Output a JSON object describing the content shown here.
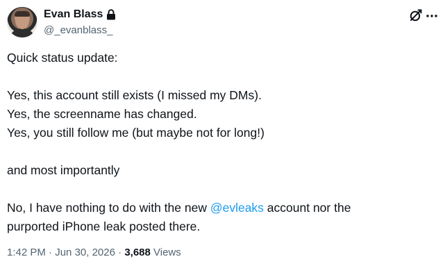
{
  "author": {
    "display_name": "Evan Blass",
    "handle": "@_evanblass_",
    "avatar_icon": "avatar-photo",
    "protected_icon": "lock-icon"
  },
  "header_actions": {
    "grok_icon": "grok-slash-icon",
    "more_icon": "more-dots-icon"
  },
  "tweet": {
    "line1": "Quick status update:",
    "line2": "Yes, this account still exists (I missed my DMs).",
    "line3": "Yes, the screenname has changed.",
    "line4": "Yes, you still follow me (but maybe not for long!)",
    "line5": "and most importantly",
    "line6_before": "No, I have nothing to do with the new ",
    "line6_mention": "@evleaks",
    "line6_after": " account nor the",
    "line7": "purported iPhone leak posted there."
  },
  "meta": {
    "time": "1:42 PM",
    "separator": " · ",
    "date": "Jun 30, 2026",
    "views_count": "3,688",
    "views_label": "Views"
  },
  "colors": {
    "text": "#0f1419",
    "secondary": "#536471",
    "link": "#1d9bf0",
    "background": "#ffffff"
  }
}
